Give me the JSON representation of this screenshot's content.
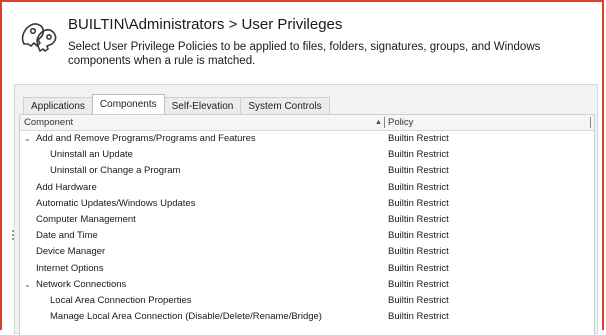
{
  "header": {
    "title": "BUILTIN\\Administrators > User Privileges",
    "description": "Select User Privilege Policies to be applied to files, folders, signatures, groups, and Windows components when a rule is matched.",
    "icon": "key-icon"
  },
  "tabs": [
    {
      "label": "Applications",
      "active": false
    },
    {
      "label": "Components",
      "active": true
    },
    {
      "label": "Self-Elevation",
      "active": false
    },
    {
      "label": "System Controls",
      "active": false
    }
  ],
  "grid": {
    "columns": {
      "component": "Component",
      "sort_indicator": "▲",
      "policy": "Policy"
    },
    "rows": [
      {
        "component": "Add and Remove Programs/Programs and Features",
        "policy": "Builtin Restrict",
        "level": 0,
        "expandable": true
      },
      {
        "component": "Uninstall an Update",
        "policy": "Builtin Restrict",
        "level": 1,
        "expandable": false
      },
      {
        "component": "Uninstall or Change a Program",
        "policy": "Builtin Restrict",
        "level": 1,
        "expandable": false
      },
      {
        "component": "Add Hardware",
        "policy": "Builtin Restrict",
        "level": 0,
        "expandable": false
      },
      {
        "component": "Automatic Updates/Windows Updates",
        "policy": "Builtin Restrict",
        "level": 0,
        "expandable": false
      },
      {
        "component": "Computer Management",
        "policy": "Builtin Restrict",
        "level": 0,
        "expandable": false
      },
      {
        "component": "Date and Time",
        "policy": "Builtin Restrict",
        "level": 0,
        "expandable": false
      },
      {
        "component": "Device Manager",
        "policy": "Builtin Restrict",
        "level": 0,
        "expandable": false
      },
      {
        "component": "Internet Options",
        "policy": "Builtin Restrict",
        "level": 0,
        "expandable": false
      },
      {
        "component": "Network Connections",
        "policy": "Builtin Restrict",
        "level": 0,
        "expandable": true
      },
      {
        "component": "Local Area Connection Properties",
        "policy": "Builtin Restrict",
        "level": 1,
        "expandable": false
      },
      {
        "component": "Manage Local Area Connection (Disable/Delete/Rename/Bridge)",
        "policy": "Builtin Restrict",
        "level": 1,
        "expandable": false
      }
    ]
  },
  "colors": {
    "accent_border": "#d9412b"
  }
}
